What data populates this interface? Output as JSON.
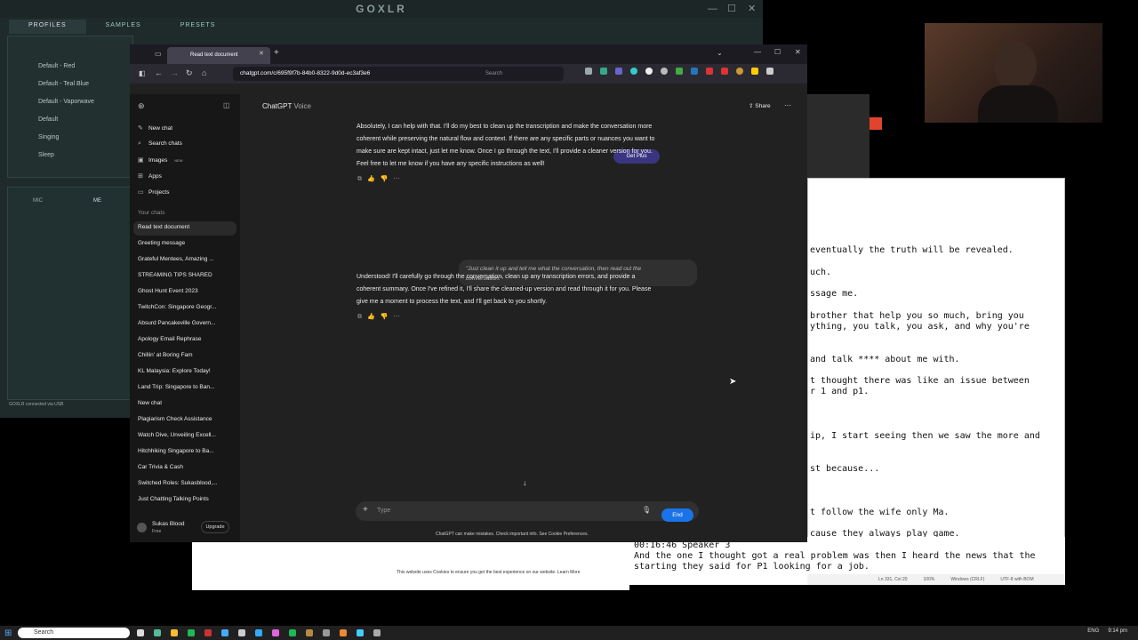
{
  "goxlr": {
    "title": "GOXLR",
    "tabs": [
      "PROFILES",
      "SAMPLES",
      "PRESETS"
    ],
    "profiles": [
      "Default - Red",
      "Default - Teal Blue",
      "Default - Vaporwave",
      "Default",
      "Singing",
      "Sleep"
    ],
    "mic_tabs": [
      "MIC",
      "ME"
    ],
    "status": "GOXLR connected via USB"
  },
  "browser": {
    "tab_title": "Read text document",
    "url": "chatgpt.com/c/695f9f7b-84b0-8322-9d0d-ec3af3e6",
    "search_placeholder": "Search"
  },
  "chatgpt": {
    "header_title": "ChatGPT",
    "header_mode": "Voice",
    "get_plus": "Get Plus",
    "share": "Share",
    "sidebar_actions": [
      {
        "label": "New chat",
        "icon": "edit-icon"
      },
      {
        "label": "Search chats",
        "icon": "search-icon"
      },
      {
        "label": "Images",
        "icon": "image-icon",
        "badge": "NEW"
      },
      {
        "label": "Apps",
        "icon": "apps-icon"
      },
      {
        "label": "Projects",
        "icon": "folder-icon"
      }
    ],
    "your_chats_heading": "Your chats",
    "chats": [
      "Read text document",
      "Greeting message",
      "Grateful Mentees, Amazing ...",
      "STREAMING TIPS SHARED",
      "Ghost Hunt Event 2023",
      "TwitchCon: Singapore Geogr...",
      "Absurd Pancakeville Govern...",
      "Apology Email Rephrase",
      "Chillin' at Boring Fam",
      "KL Malaysia: Explore Today!",
      "Land Trip: Singapore to Ban...",
      "New chat",
      "Plagiarism Check Assistance",
      "Watch Dive, Unveiling Excell...",
      "Hitchhiking Singapore to Ba...",
      "Car Trivia & Cash",
      "Switched Roles: Sukasblood,...",
      "Just Chatting Talking Points"
    ],
    "user": {
      "name": "Sukas Blood",
      "plan": "Free",
      "upgrade": "Upgrade"
    },
    "messages": {
      "assistant_1": [
        "Absolutely, I can help with that. I'll do my best to clean up the transcription and make the conversation more",
        "coherent while preserving the natural flow and context. If there are any specific parts or nuances you want to",
        "make sure are kept intact, just let me know. Once I go through the text, I'll provide a cleaner version for you.",
        "Feel free to let me know if you have any specific instructions as well!"
      ],
      "user_1": [
        "\"Just clean it up and tell me what the conversation, then read out the",
        "conversation.\""
      ],
      "assistant_2": [
        "Understood! I'll carefully go through the conversation, clean up any transcription errors, and provide a",
        "coherent summary. Once I've refined it, I'll share the cleaned-up version and read through it for you. Please",
        "give me a moment to process the text, and I'll get back to you shortly."
      ]
    },
    "composer_placeholder": "Type",
    "end_label": "End",
    "disclaimer": "ChatGPT can make mistakes. Check important info. See Cookie Preferences."
  },
  "notepad": {
    "lines": [
      "eventually the truth will be revealed.",
      "uch.",
      "ssage me.",
      "brother that help you so much, bring you",
      "ything, you talk, you ask, and why you're",
      "and talk **** about me with.",
      "t thought there was like an issue between",
      "r 1 and p1.",
      "ip, I start seeing then we saw the more and",
      "st because...",
      "t follow the wife only Ma.",
      "cause they always play game."
    ],
    "lower_lines": [
      "00:16:46 Speaker 3",
      "And the one I thought got a real problem was then I heard the news that the",
      "starting they said for P1 looking for a job."
    ],
    "status": [
      "Ln 331, Col 20",
      "100%",
      "Windows (CRLF)",
      "UTF-8 with BOM"
    ]
  },
  "cookie_text": "This website uses Cookies to ensure you get the best experience on our website. Learn More",
  "taskbar": {
    "search_placeholder": "Search",
    "language": "ENG",
    "time": "9:14 pm"
  }
}
